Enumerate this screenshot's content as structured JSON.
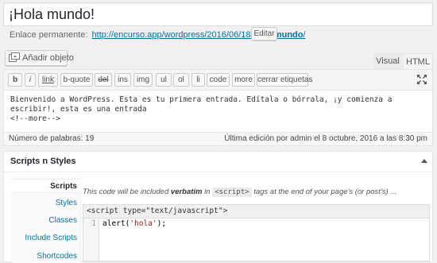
{
  "post": {
    "title": "¡Hola mundo!",
    "permalink_label": "Enlace permanente:",
    "permalink_base": "http://encurso.app/wordpress/2016/06/18/",
    "permalink_slug": "hola-mundo",
    "permalink_trailing": "/",
    "edit_label": "Editar"
  },
  "media": {
    "add_label": "Añadir objeto",
    "icon": "media-icon"
  },
  "editor_tabs": {
    "visual": "Visual",
    "html": "HTML",
    "active": "HTML"
  },
  "quicktags": [
    "b",
    "i",
    "link",
    "b-quote",
    "del",
    "ins",
    "img",
    "ul",
    "ol",
    "li",
    "code",
    "more",
    "cerrar etiquetas"
  ],
  "content": {
    "text": "Bienvenido a WordPress. Esta es tu primera entrada. Edítala o bórrala, ¡y comienza a escribir!, esta es una entrada\n<!--more-->"
  },
  "status": {
    "word_count": "Número de palabras: 19",
    "last_edit": "Última edición por admin el 8 octubre, 2016 a las 8:30 pm"
  },
  "scripts_box": {
    "title": "Scripts n Styles",
    "nav": [
      "Scripts",
      "Styles",
      "Classes",
      "Include Scripts",
      "Shortcodes"
    ],
    "active_nav": "Scripts",
    "desc_pre": "This code will be included ",
    "desc_bold": "verbatim",
    "desc_mid": " in ",
    "desc_code": "<script>",
    "desc_post": " tags at the end of your page's (or post's) ...",
    "code_header": "<script type=\"text/javascript\">",
    "code_line_number": "1",
    "code_fn": "alert(",
    "code_str": "'hola'",
    "code_end": ");"
  }
}
